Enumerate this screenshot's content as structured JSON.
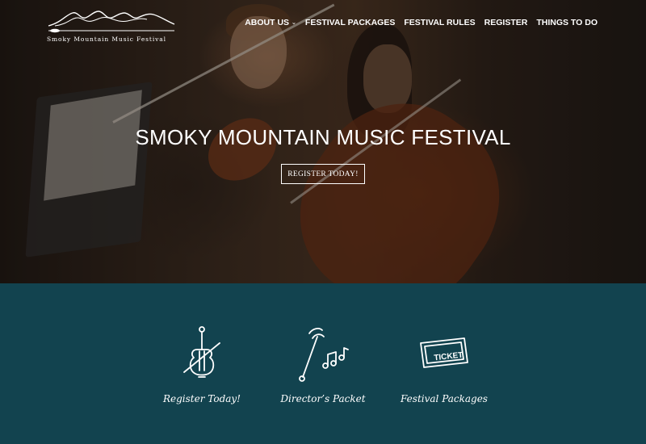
{
  "header": {
    "logo_text": "Smoky Mountain Music Festival",
    "nav": [
      {
        "label": "ABOUT US",
        "has_dropdown": true
      },
      {
        "label": "FESTIVAL PACKAGES"
      },
      {
        "label": "FESTIVAL RULES"
      },
      {
        "label": "REGISTER"
      },
      {
        "label": "THINGS TO DO"
      }
    ]
  },
  "hero": {
    "title": "SMOKY MOUNTAIN MUSIC FESTIVAL",
    "button_label": "REGISTER TODAY!"
  },
  "features": [
    {
      "icon": "violin-icon",
      "label": "Register Today!"
    },
    {
      "icon": "conductor-baton-icon",
      "label": "Director’s Packet"
    },
    {
      "icon": "ticket-icon",
      "label": "Festival Packages"
    }
  ],
  "colors": {
    "teal_section": "#12434f",
    "text": "#ffffff"
  }
}
